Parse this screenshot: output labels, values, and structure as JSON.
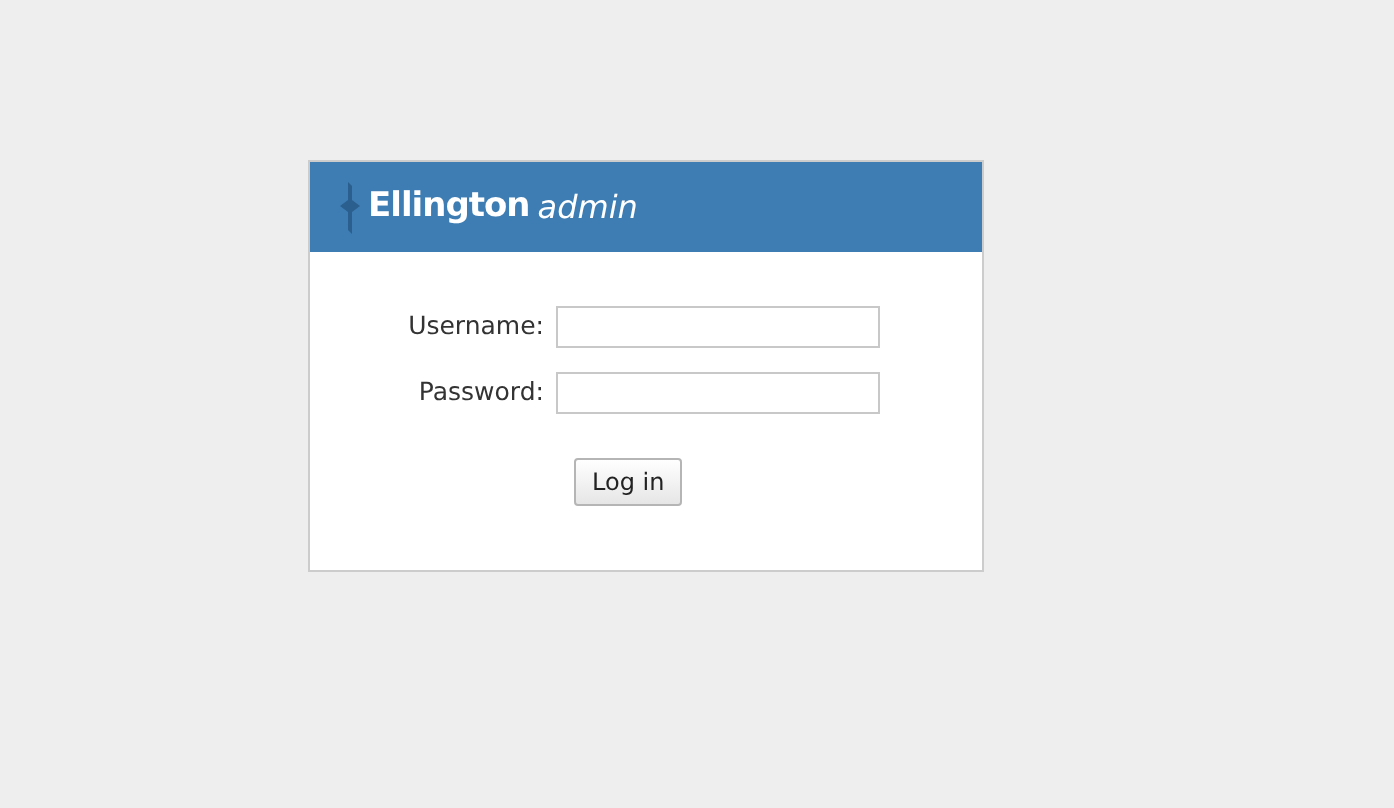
{
  "header": {
    "brand": "Ellington",
    "suffix": "admin"
  },
  "fields": [
    {
      "label": "Username:"
    },
    {
      "label": "Password:"
    }
  ],
  "button": "Log in"
}
